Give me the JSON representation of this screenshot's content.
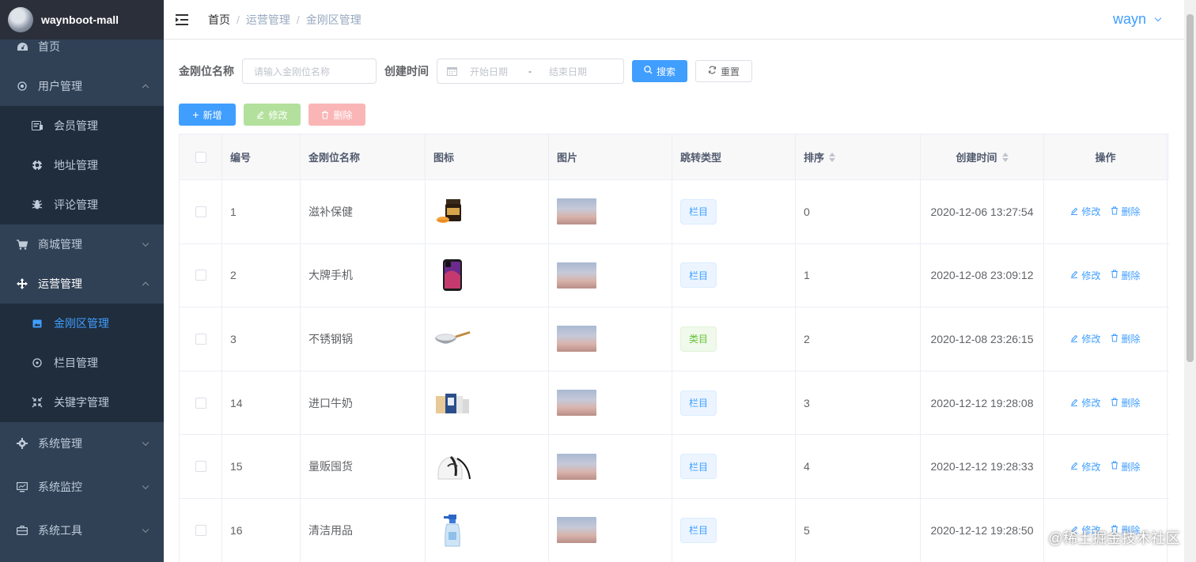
{
  "app": {
    "title": "waynboot-mall"
  },
  "header": {
    "breadcrumb": [
      "首页",
      "运营管理",
      "金刚区管理"
    ],
    "separator": "/",
    "user": "wayn"
  },
  "sidebar": {
    "items": [
      {
        "label": "首页",
        "icon": "dashboard-icon"
      },
      {
        "label": "用户管理",
        "icon": "user-icon",
        "expanded": true,
        "children": [
          {
            "label": "会员管理",
            "icon": "member-icon"
          },
          {
            "label": "地址管理",
            "icon": "address-icon"
          },
          {
            "label": "评论管理",
            "icon": "bug-icon"
          }
        ]
      },
      {
        "label": "商城管理",
        "icon": "cart-icon",
        "expanded": false
      },
      {
        "label": "运营管理",
        "icon": "move-icon",
        "expanded": true,
        "children": [
          {
            "label": "金刚区管理",
            "icon": "image-icon",
            "active": true
          },
          {
            "label": "栏目管理",
            "icon": "column-icon"
          },
          {
            "label": "关键字管理",
            "icon": "shrink-icon"
          }
        ]
      },
      {
        "label": "系统管理",
        "icon": "gear-icon",
        "expanded": false
      },
      {
        "label": "系统监控",
        "icon": "monitor-icon",
        "expanded": false
      },
      {
        "label": "系统工具",
        "icon": "tool-icon",
        "expanded": false
      }
    ]
  },
  "search": {
    "name_label": "金刚位名称",
    "name_placeholder": "请输入金刚位名称",
    "time_label": "创建时间",
    "start_placeholder": "开始日期",
    "range_sep": "-",
    "end_placeholder": "结束日期",
    "search_btn": "搜索",
    "reset_btn": "重置"
  },
  "toolbar": {
    "add": "新增",
    "edit": "修改",
    "delete": "删除"
  },
  "table": {
    "headers": [
      "编号",
      "金刚位名称",
      "图标",
      "图片",
      "跳转类型",
      "排序",
      "创建时间",
      "操作"
    ],
    "row_actions": {
      "edit": "修改",
      "delete": "删除"
    },
    "rows": [
      {
        "id": "1",
        "name": "滋补保健",
        "icon": "honey-jar-icon",
        "type": "栏目",
        "type_color": "blue",
        "sort": "0",
        "created": "2020-12-06 13:27:54"
      },
      {
        "id": "2",
        "name": "大牌手机",
        "icon": "phone-icon",
        "type": "栏目",
        "type_color": "blue",
        "sort": "1",
        "created": "2020-12-08 23:09:12"
      },
      {
        "id": "3",
        "name": "不锈钢锅",
        "icon": "pan-icon",
        "type": "类目",
        "type_color": "green",
        "sort": "2",
        "created": "2020-12-08 23:26:15"
      },
      {
        "id": "14",
        "name": "进口牛奶",
        "icon": "milk-box-icon",
        "type": "栏目",
        "type_color": "blue",
        "sort": "3",
        "created": "2020-12-12 19:28:08"
      },
      {
        "id": "15",
        "name": "量贩囤货",
        "icon": "bag-icon",
        "type": "栏目",
        "type_color": "blue",
        "sort": "4",
        "created": "2020-12-12 19:28:33"
      },
      {
        "id": "16",
        "name": "清洁用品",
        "icon": "spray-bottle-icon",
        "type": "栏目",
        "type_color": "blue",
        "sort": "5",
        "created": "2020-12-12 19:28:50"
      }
    ]
  },
  "watermark": "@稀土掘金技术社区"
}
